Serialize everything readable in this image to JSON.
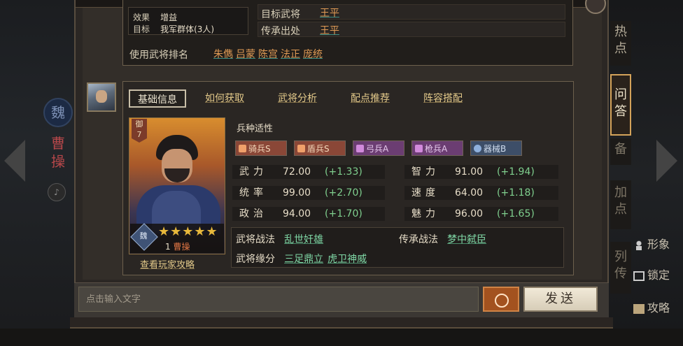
{
  "background": {
    "faction_badge": "魏",
    "general_name": "曹操"
  },
  "right_menu": {
    "items": [
      {
        "label": "形象",
        "icon": "figure-icon"
      },
      {
        "label": "锁定",
        "icon": "lock-icon"
      },
      {
        "label": "攻略",
        "icon": "scroll-icon"
      }
    ]
  },
  "side_tabs": [
    "热点",
    "问答",
    "备",
    "加点",
    "列传"
  ],
  "top_box": {
    "effect_label": "效果",
    "effect_value": "增益",
    "target_label": "目标",
    "target_value": "我军群体(3人)",
    "row1_label": "目标武将",
    "row1_value": "王平",
    "inherit_label": "传承出处",
    "inherit_value": "王平",
    "usage_label": "使用武将排名",
    "usage_names": [
      "朱儁",
      "吕蒙",
      "陈宫",
      "法正",
      "庞统"
    ]
  },
  "tabs": {
    "basic": "基础信息",
    "obtain": "如何获取",
    "analysis": "武将分析",
    "points": "配点推荐",
    "lineup": "阵容搭配"
  },
  "portrait": {
    "cost_label": "御",
    "cost_value": "7",
    "faction": "魏",
    "stars": "★★★★★",
    "level": "1",
    "name": "曹操",
    "guide_link": "查看玩家攻略"
  },
  "troops": {
    "title": "兵种适性",
    "items": [
      {
        "label": "骑兵S",
        "icon": "cavalry-icon"
      },
      {
        "label": "盾兵S",
        "icon": "shield-icon"
      },
      {
        "label": "弓兵A",
        "icon": "bow-icon"
      },
      {
        "label": "枪兵A",
        "icon": "spear-icon"
      },
      {
        "label": "器械B",
        "icon": "siege-icon"
      }
    ]
  },
  "stats": {
    "left": [
      {
        "name": "武力",
        "value": "72.00",
        "growth": "(+1.33)"
      },
      {
        "name": "统率",
        "value": "99.00",
        "growth": "(+2.70)"
      },
      {
        "name": "政治",
        "value": "94.00",
        "growth": "(+1.70)"
      }
    ],
    "right": [
      {
        "name": "智力",
        "value": "91.00",
        "growth": "(+1.94)"
      },
      {
        "name": "速度",
        "value": "64.00",
        "growth": "(+1.18)"
      },
      {
        "name": "魅力",
        "value": "96.00",
        "growth": "(+1.65)"
      }
    ]
  },
  "skills": {
    "tactic_label": "武将战法",
    "tactic_value": "乱世奸雄",
    "inherit_label": "传承战法",
    "inherit_value": "梦中弑臣",
    "fate_label": "武将缘分",
    "fate_values": [
      "三足鼎立",
      "虎卫神威"
    ]
  },
  "chat": {
    "placeholder": "点击输入文字",
    "send_label": "发送"
  },
  "colors": {
    "accent_gold": "#e3c98a",
    "growth_green": "#7fcf8e",
    "skill_green": "#7fd7a5",
    "name_orange": "#e09b55"
  }
}
